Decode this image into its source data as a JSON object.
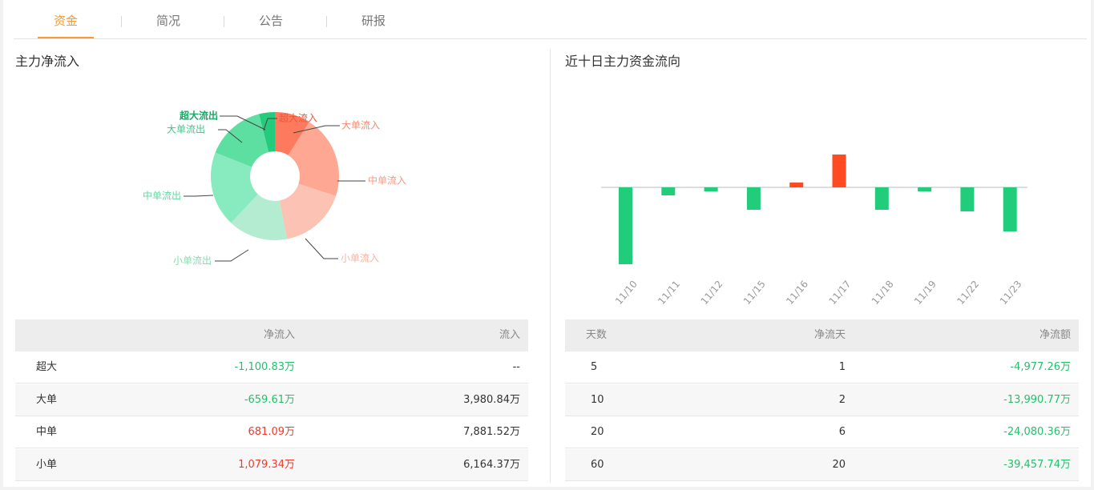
{
  "tabs": [
    "资金",
    "简况",
    "公告",
    "研报"
  ],
  "active_tab": 0,
  "left_title": "主力净流入",
  "right_title": "近十日主力资金流向",
  "pie_labels": {
    "super_out": "超大流出",
    "large_out": "大单流出",
    "mid_out": "中单流出",
    "small_out": "小单流出",
    "super_in": "超大流入",
    "large_in": "大单流入",
    "mid_in": "中单流入",
    "small_in": "小单流入"
  },
  "colors": {
    "accent": "#f49a36",
    "up": "#f0392b",
    "down": "#21c26b",
    "bar_up": "#ff4a22",
    "bar_down": "#21cd7b"
  },
  "flow_table": {
    "headers": [
      "",
      "净流入",
      "流入"
    ],
    "rows": [
      {
        "name": "超大",
        "net": "-1,100.83万",
        "inflow": "--",
        "dir": "down"
      },
      {
        "name": "大单",
        "net": "-659.61万",
        "inflow": "3,980.84万",
        "dir": "down"
      },
      {
        "name": "中单",
        "net": "681.09万",
        "inflow": "7,881.52万",
        "dir": "up"
      },
      {
        "name": "小单",
        "net": "1,079.34万",
        "inflow": "6,164.37万",
        "dir": "up"
      }
    ]
  },
  "days_table": {
    "headers": [
      "天数",
      "净流天",
      "净流额"
    ],
    "rows": [
      {
        "days": "5",
        "net_days": "1",
        "amount": "-4,977.26万"
      },
      {
        "days": "10",
        "net_days": "2",
        "amount": "-13,990.77万"
      },
      {
        "days": "20",
        "net_days": "6",
        "amount": "-24,080.36万"
      },
      {
        "days": "60",
        "net_days": "20",
        "amount": "-39,457.74万"
      }
    ]
  },
  "chart_data": [
    {
      "type": "pie",
      "title": "",
      "donut": true,
      "slices": [
        {
          "label": "超大流入",
          "value": 9,
          "color": "#fe7a5e"
        },
        {
          "label": "中单流入",
          "value": 21,
          "color": "#fea792"
        },
        {
          "label": "小单流入",
          "value": 17,
          "color": "#fcc3b4"
        },
        {
          "label": "小单流出",
          "value": 15,
          "color": "#b3ecd0"
        },
        {
          "label": "中单流出",
          "value": 19,
          "color": "#88ebbf"
        },
        {
          "label": "大单流出",
          "value": 15,
          "color": "#5ddfa1"
        },
        {
          "label": "超大流出",
          "value": 4,
          "color": "#23cb7d"
        }
      ]
    },
    {
      "type": "bar",
      "title": "",
      "categories": [
        "11/10",
        "11/11",
        "11/12",
        "11/15",
        "11/16",
        "11/17",
        "11/18",
        "11/19",
        "11/22",
        "11/23"
      ],
      "values": [
        -96,
        -10,
        -5,
        -28,
        6,
        41,
        -28,
        -5,
        -30,
        -55
      ],
      "ylim": [
        -100,
        45
      ],
      "grid": false
    }
  ]
}
